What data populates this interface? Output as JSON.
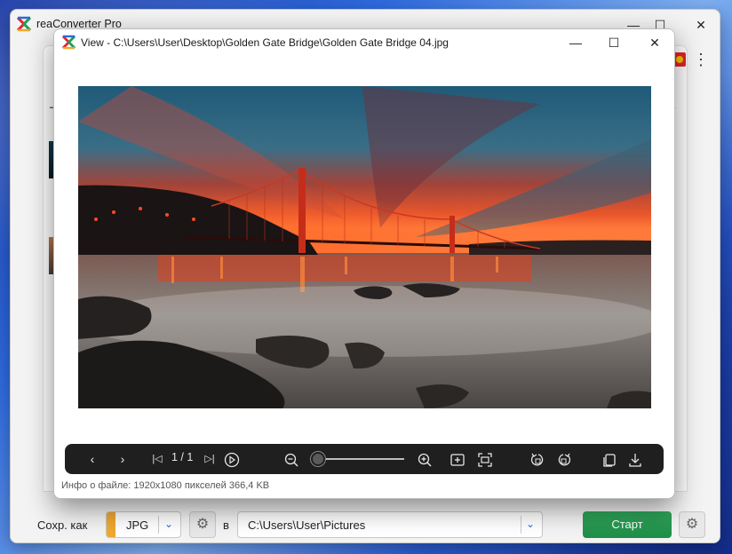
{
  "main_window": {
    "title": "reaConverter Pro",
    "controls": {
      "minimize": "—",
      "maximize": "☐",
      "close": "✕"
    }
  },
  "bottom_bar": {
    "save_as_label": "Сохр. как",
    "format": "JPG",
    "in_label": "в",
    "output_path": "C:\\Users\\User\\Pictures",
    "start_label": "Старт"
  },
  "viewer": {
    "title": "View - C:\\Users\\User\\Desktop\\Golden Gate Bridge\\Golden Gate Bridge 04.jpg",
    "controls": {
      "minimize": "—",
      "maximize": "☐",
      "close": "✕"
    },
    "page_counter": "1 / 1",
    "zoom_level_fraction": 0.05,
    "file_info": "Инфо о файле: 1920x1080 пикселей 366,4 KB"
  },
  "colors": {
    "accent_format": "#f0a830",
    "start_button": "#2a9d55",
    "link_blue": "#2a6bd1",
    "toolbar_bg": "#1f1f1f"
  }
}
